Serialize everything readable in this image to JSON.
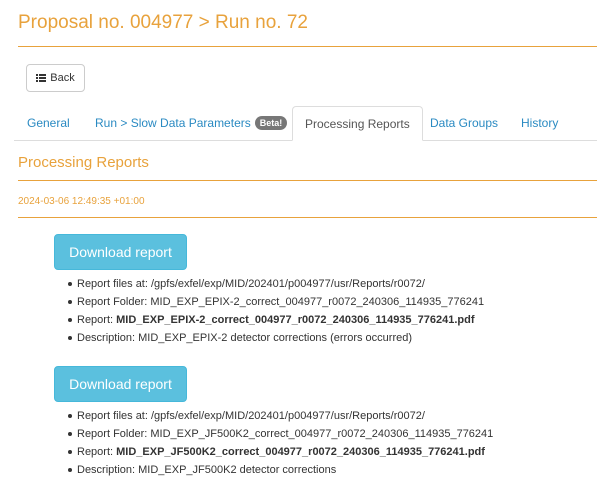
{
  "header": {
    "title": "Proposal no. 004977 > Run no. 72"
  },
  "back_button": {
    "label": "Back",
    "icon": "list-icon"
  },
  "tabs": [
    {
      "label": "General",
      "active": false
    },
    {
      "label": "Run > Slow Data Parameters",
      "badge": "Beta!",
      "active": false
    },
    {
      "label": "Processing Reports",
      "active": true
    },
    {
      "label": "Data Groups",
      "active": false
    },
    {
      "label": "History",
      "active": false
    }
  ],
  "section": {
    "title": "Processing Reports",
    "timestamp": "2024-03-06 12:49:35 +01:00"
  },
  "reports": [
    {
      "button_label": "Download report",
      "files_label": "Report files at:",
      "files_value": "/gpfs/exfel/exp/MID/202401/p004977/usr/Reports/r0072/",
      "folder_label": "Report Folder:",
      "folder_value": "MID_EXP_EPIX-2_correct_004977_r0072_240306_114935_776241",
      "report_label": "Report:",
      "report_value": "MID_EXP_EPIX-2_correct_004977_r0072_240306_114935_776241.pdf",
      "description_label": "Description:",
      "description_value": "MID_EXP_EPIX-2 detector corrections (errors occurred)"
    },
    {
      "button_label": "Download report",
      "files_label": "Report files at:",
      "files_value": "/gpfs/exfel/exp/MID/202401/p004977/usr/Reports/r0072/",
      "folder_label": "Report Folder:",
      "folder_value": "MID_EXP_JF500K2_correct_004977_r0072_240306_114935_776241",
      "report_label": "Report:",
      "report_value": "MID_EXP_JF500K2_correct_004977_r0072_240306_114935_776241.pdf",
      "description_label": "Description:",
      "description_value": "MID_EXP_JF500K2 detector corrections"
    }
  ],
  "colors": {
    "accent": "#e8a23c",
    "link": "#2a8ac2",
    "button_info": "#5bc0de",
    "badge": "#777777"
  }
}
